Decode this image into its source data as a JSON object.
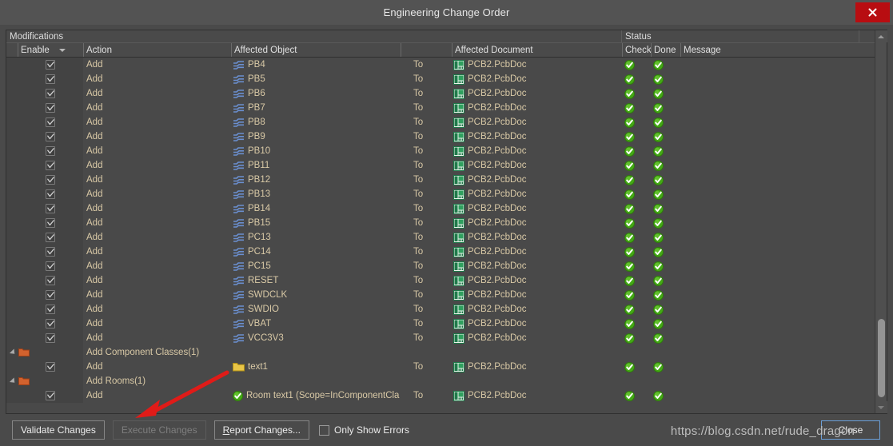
{
  "window": {
    "title": "Engineering Change Order",
    "close_icon": "close-x-icon"
  },
  "grid": {
    "band_headers": {
      "modifications": "Modifications",
      "status": "Status"
    },
    "columns": {
      "enable": "Enable",
      "action": "Action",
      "affected_object": "Affected Object",
      "to": "",
      "affected_document": "Affected Document",
      "check": "Check",
      "done": "Done",
      "message": "Message"
    },
    "sort_caret_icon": "sort-descending-caret-icon",
    "rows": [
      {
        "type": "item",
        "enabled": true,
        "action": "Add",
        "object_icon": "net-icon",
        "object": "PB4",
        "to": "To",
        "doc_icon": "pcb-document-icon",
        "document": "PCB2.PcbDoc",
        "check": "check-ok-icon",
        "done": "check-ok-icon",
        "message": ""
      },
      {
        "type": "item",
        "enabled": true,
        "action": "Add",
        "object_icon": "net-icon",
        "object": "PB5",
        "to": "To",
        "doc_icon": "pcb-document-icon",
        "document": "PCB2.PcbDoc",
        "check": "check-ok-icon",
        "done": "check-ok-icon",
        "message": ""
      },
      {
        "type": "item",
        "enabled": true,
        "action": "Add",
        "object_icon": "net-icon",
        "object": "PB6",
        "to": "To",
        "doc_icon": "pcb-document-icon",
        "document": "PCB2.PcbDoc",
        "check": "check-ok-icon",
        "done": "check-ok-icon",
        "message": ""
      },
      {
        "type": "item",
        "enabled": true,
        "action": "Add",
        "object_icon": "net-icon",
        "object": "PB7",
        "to": "To",
        "doc_icon": "pcb-document-icon",
        "document": "PCB2.PcbDoc",
        "check": "check-ok-icon",
        "done": "check-ok-icon",
        "message": ""
      },
      {
        "type": "item",
        "enabled": true,
        "action": "Add",
        "object_icon": "net-icon",
        "object": "PB8",
        "to": "To",
        "doc_icon": "pcb-document-icon",
        "document": "PCB2.PcbDoc",
        "check": "check-ok-icon",
        "done": "check-ok-icon",
        "message": ""
      },
      {
        "type": "item",
        "enabled": true,
        "action": "Add",
        "object_icon": "net-icon",
        "object": "PB9",
        "to": "To",
        "doc_icon": "pcb-document-icon",
        "document": "PCB2.PcbDoc",
        "check": "check-ok-icon",
        "done": "check-ok-icon",
        "message": ""
      },
      {
        "type": "item",
        "enabled": true,
        "action": "Add",
        "object_icon": "net-icon",
        "object": "PB10",
        "to": "To",
        "doc_icon": "pcb-document-icon",
        "document": "PCB2.PcbDoc",
        "check": "check-ok-icon",
        "done": "check-ok-icon",
        "message": ""
      },
      {
        "type": "item",
        "enabled": true,
        "action": "Add",
        "object_icon": "net-icon",
        "object": "PB11",
        "to": "To",
        "doc_icon": "pcb-document-icon",
        "document": "PCB2.PcbDoc",
        "check": "check-ok-icon",
        "done": "check-ok-icon",
        "message": ""
      },
      {
        "type": "item",
        "enabled": true,
        "action": "Add",
        "object_icon": "net-icon",
        "object": "PB12",
        "to": "To",
        "doc_icon": "pcb-document-icon",
        "document": "PCB2.PcbDoc",
        "check": "check-ok-icon",
        "done": "check-ok-icon",
        "message": ""
      },
      {
        "type": "item",
        "enabled": true,
        "action": "Add",
        "object_icon": "net-icon",
        "object": "PB13",
        "to": "To",
        "doc_icon": "pcb-document-icon",
        "document": "PCB2.PcbDoc",
        "check": "check-ok-icon",
        "done": "check-ok-icon",
        "message": ""
      },
      {
        "type": "item",
        "enabled": true,
        "action": "Add",
        "object_icon": "net-icon",
        "object": "PB14",
        "to": "To",
        "doc_icon": "pcb-document-icon",
        "document": "PCB2.PcbDoc",
        "check": "check-ok-icon",
        "done": "check-ok-icon",
        "message": ""
      },
      {
        "type": "item",
        "enabled": true,
        "action": "Add",
        "object_icon": "net-icon",
        "object": "PB15",
        "to": "To",
        "doc_icon": "pcb-document-icon",
        "document": "PCB2.PcbDoc",
        "check": "check-ok-icon",
        "done": "check-ok-icon",
        "message": ""
      },
      {
        "type": "item",
        "enabled": true,
        "action": "Add",
        "object_icon": "net-icon",
        "object": "PC13",
        "to": "To",
        "doc_icon": "pcb-document-icon",
        "document": "PCB2.PcbDoc",
        "check": "check-ok-icon",
        "done": "check-ok-icon",
        "message": ""
      },
      {
        "type": "item",
        "enabled": true,
        "action": "Add",
        "object_icon": "net-icon",
        "object": "PC14",
        "to": "To",
        "doc_icon": "pcb-document-icon",
        "document": "PCB2.PcbDoc",
        "check": "check-ok-icon",
        "done": "check-ok-icon",
        "message": ""
      },
      {
        "type": "item",
        "enabled": true,
        "action": "Add",
        "object_icon": "net-icon",
        "object": "PC15",
        "to": "To",
        "doc_icon": "pcb-document-icon",
        "document": "PCB2.PcbDoc",
        "check": "check-ok-icon",
        "done": "check-ok-icon",
        "message": ""
      },
      {
        "type": "item",
        "enabled": true,
        "action": "Add",
        "object_icon": "net-icon",
        "object": "RESET",
        "to": "To",
        "doc_icon": "pcb-document-icon",
        "document": "PCB2.PcbDoc",
        "check": "check-ok-icon",
        "done": "check-ok-icon",
        "message": ""
      },
      {
        "type": "item",
        "enabled": true,
        "action": "Add",
        "object_icon": "net-icon",
        "object": "SWDCLK",
        "to": "To",
        "doc_icon": "pcb-document-icon",
        "document": "PCB2.PcbDoc",
        "check": "check-ok-icon",
        "done": "check-ok-icon",
        "message": ""
      },
      {
        "type": "item",
        "enabled": true,
        "action": "Add",
        "object_icon": "net-icon",
        "object": "SWDIO",
        "to": "To",
        "doc_icon": "pcb-document-icon",
        "document": "PCB2.PcbDoc",
        "check": "check-ok-icon",
        "done": "check-ok-icon",
        "message": ""
      },
      {
        "type": "item",
        "enabled": true,
        "action": "Add",
        "object_icon": "net-icon",
        "object": "VBAT",
        "to": "To",
        "doc_icon": "pcb-document-icon",
        "document": "PCB2.PcbDoc",
        "check": "check-ok-icon",
        "done": "check-ok-icon",
        "message": ""
      },
      {
        "type": "item",
        "enabled": true,
        "action": "Add",
        "object_icon": "net-icon",
        "object": "VCC3V3",
        "to": "To",
        "doc_icon": "pcb-document-icon",
        "document": "PCB2.PcbDoc",
        "check": "check-ok-icon",
        "done": "check-ok-icon",
        "message": ""
      },
      {
        "type": "group",
        "expand_icon": "collapse-triangle-icon",
        "group_icon": "orange-folder-icon",
        "action": "Add Component Classes(1)"
      },
      {
        "type": "item",
        "enabled": true,
        "action": "Add",
        "object_icon": "yellow-folder-icon",
        "object": "text1",
        "to": "To",
        "doc_icon": "pcb-document-icon",
        "document": "PCB2.PcbDoc",
        "check": "check-ok-icon",
        "done": "check-ok-icon",
        "message": ""
      },
      {
        "type": "group",
        "expand_icon": "collapse-triangle-icon",
        "group_icon": "orange-folder-icon",
        "action": "Add Rooms(1)"
      },
      {
        "type": "item",
        "enabled": true,
        "action": "Add",
        "object_icon": "check-ok-icon",
        "object": "Room text1 (Scope=InComponentCla",
        "to": "To",
        "doc_icon": "pcb-document-icon",
        "document": "PCB2.PcbDoc",
        "check": "check-ok-icon",
        "done": "check-ok-icon",
        "message": ""
      }
    ]
  },
  "scrollbar": {
    "up_icon": "scroll-up-arrow-icon",
    "down_icon": "scroll-down-arrow-icon",
    "thumb_top_pct": 77,
    "thumb_height_pct": 22
  },
  "toolbar": {
    "validate_label": "Validate Changes",
    "execute_label": "Execute Changes",
    "execute_disabled": true,
    "report_label": "Report Changes...",
    "report_accel": "R",
    "only_show_errors_label": "Only Show Errors",
    "only_show_errors_checked": false,
    "close_label": "Close"
  },
  "overlay": {
    "watermark": "https://blog.csdn.net/rude_dragon",
    "arrow_icon": "red-pointer-arrow-icon"
  },
  "colors": {
    "accent_red": "#b80d11",
    "window_bg": "#4a4a4a",
    "titlebar_bg": "#535353",
    "row_text": "#d9c9a6",
    "net_blue": "#6a8fd0",
    "ok_green": "#43a815",
    "folder_orange": "#d2622e",
    "folder_yellow": "#e8c547",
    "doc_green": "#1f7a4a",
    "focus_blue": "#6b9fd8"
  }
}
